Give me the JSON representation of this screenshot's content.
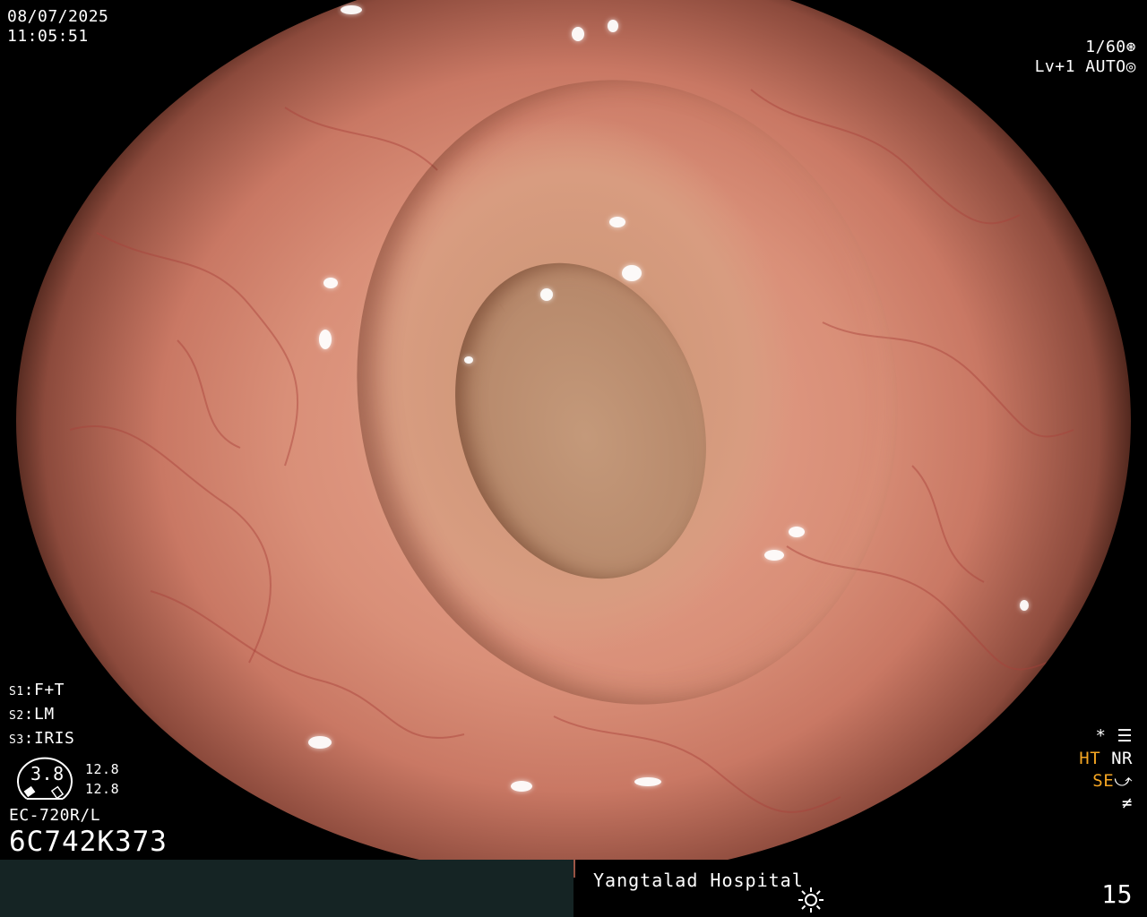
{
  "datetime": {
    "date": "08/07/2025",
    "time": "11:05:51"
  },
  "exposure": {
    "shutter": "1/60",
    "shutter_icon": "aperture-icon",
    "level": "Lv+1",
    "mode": "AUTO",
    "mode_icon": "auto-iris-icon"
  },
  "settings": [
    {
      "key": "S1",
      "value": "F+T"
    },
    {
      "key": "S2",
      "value": "LM"
    },
    {
      "key": "S3",
      "value": "IRIS"
    }
  ],
  "gauge": {
    "value": "3.8",
    "upper": "12.8",
    "lower": "12.8"
  },
  "scope": {
    "model": "EC-720R/L",
    "serial": "6C742K373"
  },
  "right_status": {
    "star": "*",
    "ht": "HT",
    "nr": "NR",
    "se": "SE",
    "ht_color": "#f5a623",
    "se_color": "#f5a623"
  },
  "footer": {
    "hospital": "Yangtalad Hospital",
    "frame": "15",
    "icon": "sun-icon"
  }
}
